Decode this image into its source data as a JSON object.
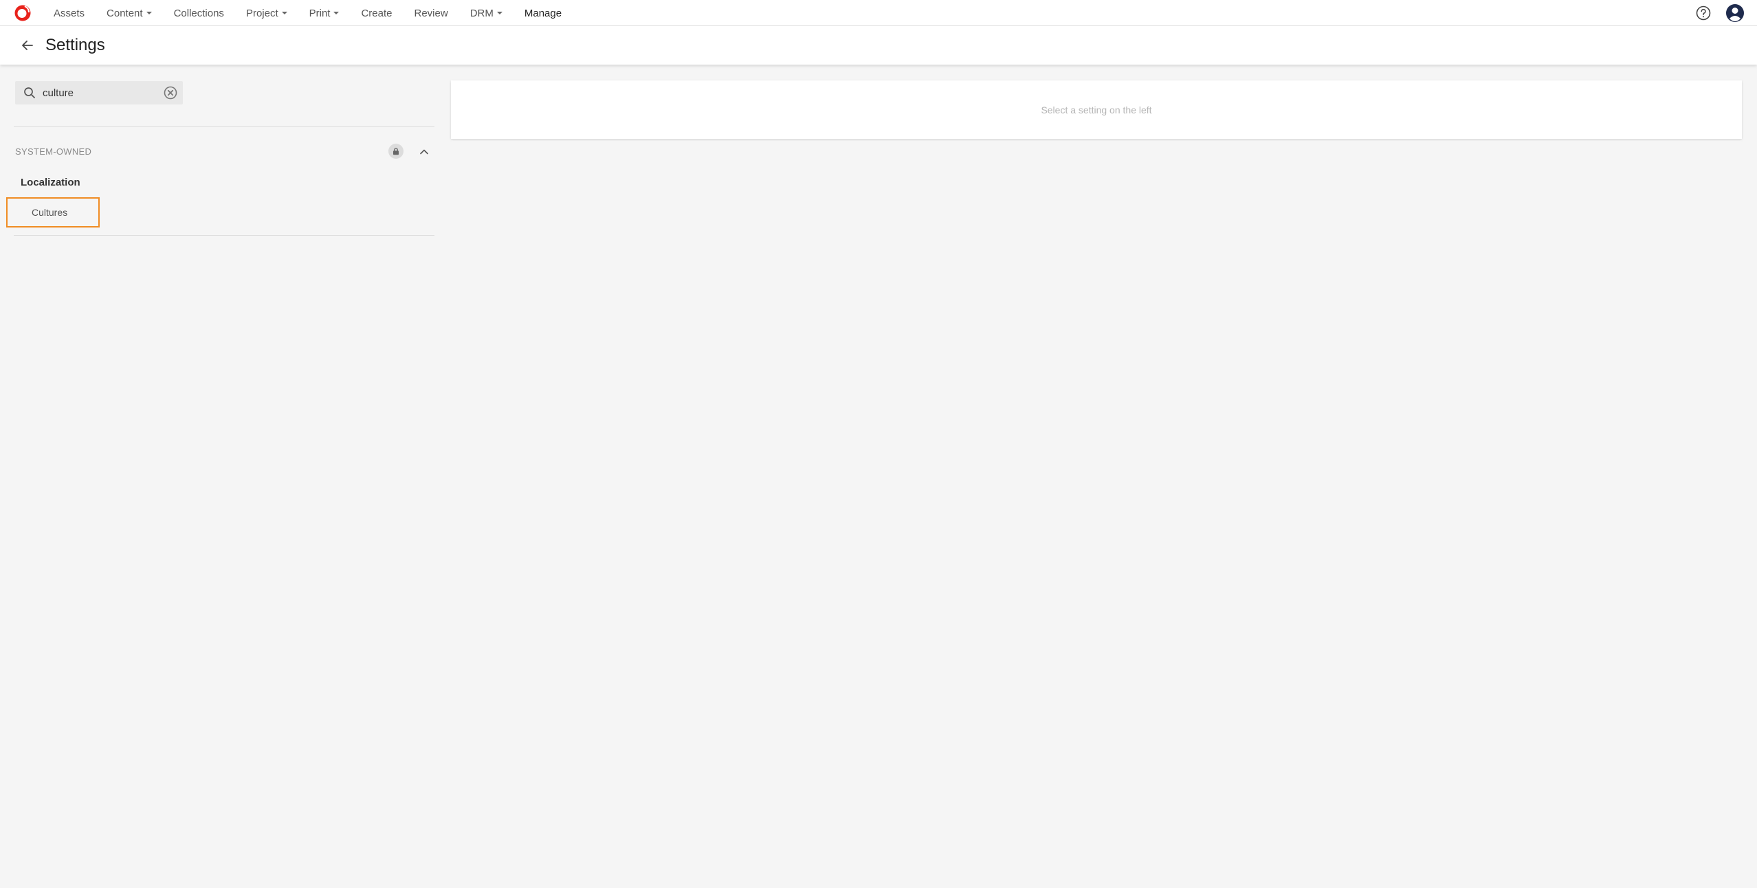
{
  "nav": {
    "items": [
      {
        "label": "Assets",
        "dropdown": false
      },
      {
        "label": "Content",
        "dropdown": true
      },
      {
        "label": "Collections",
        "dropdown": false
      },
      {
        "label": "Project",
        "dropdown": true
      },
      {
        "label": "Print",
        "dropdown": true
      },
      {
        "label": "Create",
        "dropdown": false
      },
      {
        "label": "Review",
        "dropdown": false
      },
      {
        "label": "DRM",
        "dropdown": true
      },
      {
        "label": "Manage",
        "dropdown": false,
        "active": true
      }
    ],
    "icons": {
      "logo": "brand-logo-icon",
      "help": "help-circle-icon",
      "avatar": "user-avatar-icon"
    }
  },
  "header": {
    "title": "Settings",
    "back_icon": "arrow-left-icon"
  },
  "search": {
    "value": "culture",
    "placeholder": ""
  },
  "section": {
    "label": "SYSTEM-OWNED",
    "icons": [
      "lock-icon",
      "chevron-up-icon"
    ]
  },
  "group": {
    "title": "Localization",
    "items": [
      {
        "label": "Cultures",
        "selected": true
      }
    ]
  },
  "main": {
    "empty_message": "Select a setting on the left"
  },
  "colors": {
    "accent": "#f08c24",
    "brand": "#e8221b",
    "avatar": "#1f2b4d",
    "background": "#f5f5f5"
  }
}
